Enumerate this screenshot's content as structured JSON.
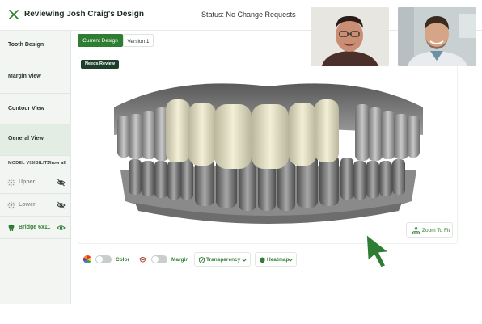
{
  "header": {
    "title": "Reviewing Josh Craig's Design",
    "status": "Status: No Change Requests"
  },
  "sidebar": {
    "items": [
      {
        "label": "Tooth Design"
      },
      {
        "label": "Margin View"
      },
      {
        "label": "Contour View"
      },
      {
        "label": "General View",
        "active": true
      }
    ],
    "model_visibility": {
      "heading": "MODEL VISIBILITY",
      "show_all": "Show all",
      "rows": [
        {
          "label": "Upper",
          "visible": false
        },
        {
          "label": "Lower",
          "visible": false
        },
        {
          "label": "Bridge 6x11",
          "visible": true
        }
      ]
    }
  },
  "tabs": [
    {
      "label": "Current Design",
      "selected": true
    },
    {
      "label": "Version 1",
      "selected": false
    }
  ],
  "viewer": {
    "badge": "Needs Review",
    "zoom_label": "Zoom To Fit"
  },
  "toolbar": {
    "color_label": "Color",
    "margin_label": "Margin",
    "transparency_label": "Transparency",
    "heatmap_label": "Heatmap"
  },
  "colors": {
    "accent": "#2e7d32",
    "badge_bg": "#1f3d2b",
    "sidebar_bg": "#f3f5f3",
    "active_item_bg": "#e4ede4"
  },
  "icons": [
    "close-icon",
    "tooth-icon",
    "eye-off-icon",
    "eye-icon",
    "zoom-fit-icon",
    "color-wheel-icon",
    "shield-icon",
    "chevron-down-icon",
    "cursor-arrow-icon"
  ]
}
